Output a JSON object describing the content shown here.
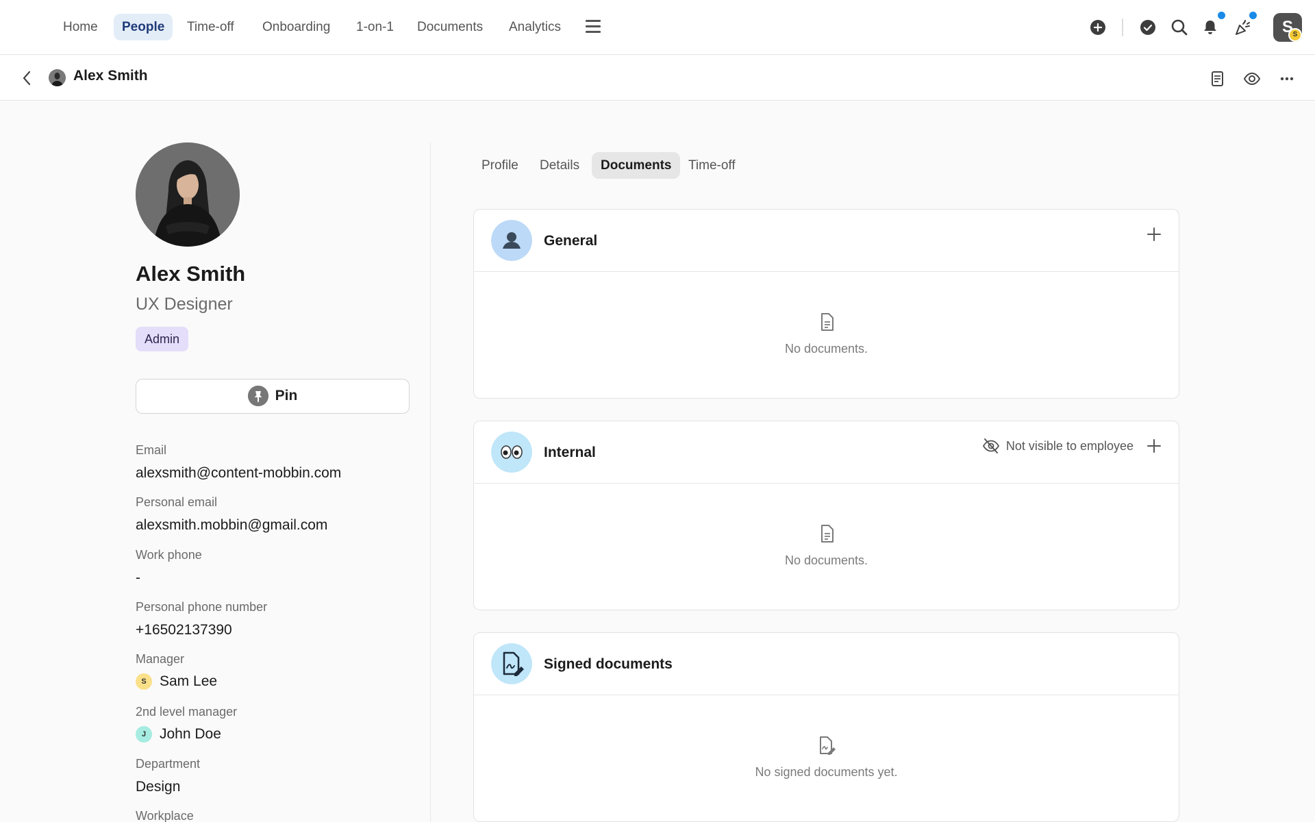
{
  "nav": {
    "items": [
      "Home",
      "People",
      "Time-off",
      "Onboarding",
      "1-on-1",
      "Documents",
      "Analytics"
    ],
    "active": "People",
    "user_initial": "S",
    "user_sub_initial": "S"
  },
  "subheader": {
    "title": "Alex Smith"
  },
  "profile": {
    "name": "Alex Smith",
    "role": "UX Designer",
    "badge": "Admin",
    "pin_label": "Pin",
    "fields": {
      "email_label": "Email",
      "email": "alexsmith@content-mobbin.com",
      "personal_email_label": "Personal email",
      "personal_email": "alexsmith.mobbin@gmail.com",
      "work_phone_label": "Work phone",
      "work_phone": "-",
      "personal_phone_label": "Personal phone number",
      "personal_phone": "+16502137390",
      "manager_label": "Manager",
      "manager_initial": "S",
      "manager": "Sam Lee",
      "second_manager_label": "2nd level manager",
      "second_manager_initial": "J",
      "second_manager": "John Doe",
      "department_label": "Department",
      "department": "Design",
      "workplace_label": "Workplace"
    }
  },
  "tabs": [
    "Profile",
    "Details",
    "Documents",
    "Time-off"
  ],
  "active_tab": "Documents",
  "cards": {
    "general": {
      "title": "General",
      "empty": "No documents."
    },
    "internal": {
      "title": "Internal",
      "visibility": "Not visible to employee",
      "empty": "No documents."
    },
    "signed": {
      "title": "Signed documents",
      "empty": "No signed documents yet."
    }
  },
  "colors": {
    "accent_dot": "#1a8ae8",
    "active_nav_bg": "#e3edf8",
    "badge_bg": "#e4defa",
    "manager_avatar": "#fbe08a",
    "second_manager_avatar": "#a6ece0"
  }
}
